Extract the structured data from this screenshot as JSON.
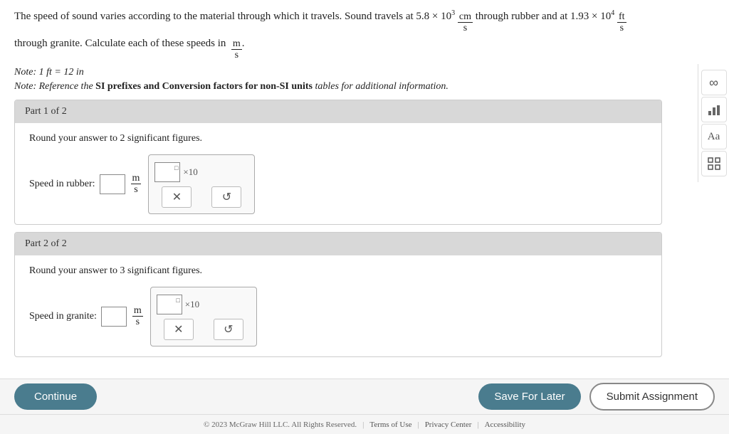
{
  "page": {
    "intro": {
      "line1": "The speed of sound varies according to the material through which it travels. Sound travels at 5.8 × 10",
      "exp1": "3",
      "unit1_num": "cm",
      "unit1_den": "s",
      "line2": "through rubber and at 1.93 × 10",
      "exp2": "4",
      "unit2_num": "ft",
      "unit2_den": "s",
      "line3": "through granite. Calculate each of these speeds in",
      "unit3_num": "m",
      "unit3_den": "s"
    },
    "notes": [
      {
        "label": "Note:",
        "text": " 1 ft = 12 in"
      },
      {
        "label": "Note:",
        "text": " Reference the ",
        "bold": "SI prefixes and Conversion factors for non-SI units",
        "text2": " tables for additional information."
      }
    ],
    "part1": {
      "header": "Part 1 of 2",
      "round_note": "Round your answer to 2 significant figures.",
      "label": "Speed in rubber:",
      "unit_num": "m",
      "unit_den": "s"
    },
    "part2": {
      "header": "Part 2 of 2",
      "round_note": "Round your answer to 3 significant figures.",
      "label": "Speed in granite:",
      "unit_num": "m",
      "unit_den": "s"
    },
    "sidebar_icons": [
      {
        "name": "infinity-icon",
        "symbol": "∞"
      },
      {
        "name": "chart-icon",
        "symbol": "📊"
      },
      {
        "name": "text-icon",
        "symbol": "Aa"
      },
      {
        "name": "grid-icon",
        "symbol": "⊞"
      }
    ],
    "bottom": {
      "continue_label": "Continue",
      "save_label": "Save For Later",
      "submit_label": "Submit Assignment"
    },
    "footer": {
      "copyright": "© 2023 McGraw Hill LLC. All Rights Reserved.",
      "terms": "Terms of Use",
      "privacy": "Privacy Center",
      "accessibility": "Accessibility"
    }
  }
}
